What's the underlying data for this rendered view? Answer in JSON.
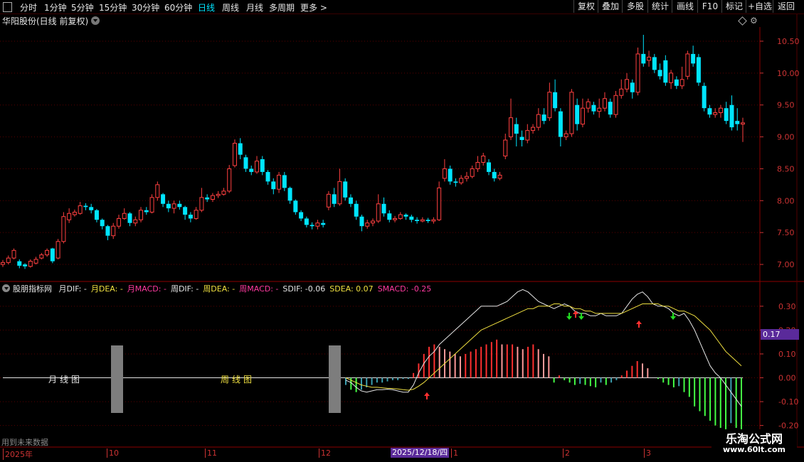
{
  "toolbar": {
    "periods": [
      "分时",
      "1分钟",
      "5分钟",
      "15分钟",
      "30分钟",
      "60分钟",
      "日线",
      "周线",
      "月线",
      "多周期",
      "更多"
    ],
    "active_period": "日线",
    "right_buttons": [
      "复权",
      "叠加",
      "多股",
      "统计",
      "画线",
      "F10",
      "标记",
      "+自选",
      "返回"
    ]
  },
  "chart_title": "华阳股份(日线 前复权)",
  "price_axis": [
    "10.50",
    "10.00",
    "9.50",
    "9.00",
    "8.50",
    "8.00",
    "7.50",
    "7.00"
  ],
  "indicator": {
    "name": "股朋指标网",
    "items": [
      {
        "text": "月DIF: -",
        "color": "#e6e6e6"
      },
      {
        "text": "月DEA: -",
        "color": "#f0e040"
      },
      {
        "text": "月MACD: -",
        "color": "#ff3aa0"
      },
      {
        "text": "周DIF: -",
        "color": "#e6e6e6"
      },
      {
        "text": "周DEA: -",
        "color": "#f0e040"
      },
      {
        "text": "周MACD: -",
        "color": "#ff3aa0"
      },
      {
        "text": "SDIF: -0.06",
        "color": "#e6e6e6"
      },
      {
        "text": "SDEA: 0.07",
        "color": "#f0e040"
      },
      {
        "text": "SMACD: -0.25",
        "color": "#ff3aa0"
      }
    ],
    "axis": [
      "0.30",
      "0.20",
      "0.10",
      "0.00",
      "-0.10",
      "-0.20"
    ],
    "current_value": "0.17",
    "month_label": "月线图",
    "week_label": "周线图"
  },
  "bottom_note": "用到未来数据",
  "date_axis": {
    "labels": [
      "2025年",
      "10",
      "11",
      "12",
      "1",
      "2",
      "3"
    ],
    "cursor_date": "2025/12/18/四"
  },
  "watermark": {
    "title": "乐淘公式网",
    "url": "www.60lt.com"
  },
  "colors": {
    "up": "#ff4040",
    "down": "#00e5ff",
    "grid": "#5a0000",
    "axis": "#cc3333"
  },
  "chart_data": {
    "type": "candlestick",
    "title": "华阳股份(日线 前复权)",
    "ylim": [
      6.8,
      10.7
    ],
    "candles": [
      [
        7.0,
        7.03,
        7.07,
        6.96
      ],
      [
        7.03,
        7.1,
        7.14,
        7.0
      ],
      [
        7.1,
        7.22,
        7.25,
        7.08
      ],
      [
        7.05,
        6.98,
        7.08,
        6.94
      ],
      [
        7.0,
        6.97,
        7.02,
        6.93
      ],
      [
        6.97,
        7.05,
        7.08,
        6.95
      ],
      [
        7.02,
        7.08,
        7.12,
        7.0
      ],
      [
        7.1,
        7.15,
        7.18,
        7.08
      ],
      [
        7.15,
        7.22,
        7.25,
        7.12
      ],
      [
        7.25,
        7.05,
        7.26,
        7.02
      ],
      [
        7.1,
        7.36,
        7.4,
        7.08
      ],
      [
        7.36,
        7.75,
        7.82,
        7.33
      ],
      [
        7.7,
        7.8,
        7.88,
        7.65
      ],
      [
        7.78,
        7.82,
        7.86,
        7.75
      ],
      [
        7.8,
        7.92,
        7.98,
        7.78
      ],
      [
        7.92,
        7.9,
        7.96,
        7.85
      ],
      [
        7.9,
        7.85,
        7.95,
        7.8
      ],
      [
        7.85,
        7.7,
        7.87,
        7.66
      ],
      [
        7.7,
        7.6,
        7.72,
        7.55
      ],
      [
        7.6,
        7.45,
        7.62,
        7.38
      ],
      [
        7.45,
        7.6,
        7.65,
        7.4
      ],
      [
        7.6,
        7.72,
        7.78,
        7.56
      ],
      [
        7.72,
        7.8,
        7.88,
        7.7
      ],
      [
        7.8,
        7.65,
        7.82,
        7.6
      ],
      [
        7.65,
        7.7,
        7.75,
        7.6
      ],
      [
        7.7,
        7.85,
        7.9,
        7.66
      ],
      [
        7.85,
        7.82,
        7.9,
        7.78
      ],
      [
        7.82,
        8.05,
        8.1,
        7.8
      ],
      [
        8.05,
        8.25,
        8.3,
        8.0
      ],
      [
        8.1,
        7.95,
        8.12,
        7.9
      ],
      [
        7.95,
        7.88,
        8.0,
        7.82
      ],
      [
        7.88,
        7.95,
        8.0,
        7.8
      ],
      [
        7.95,
        7.9,
        8.0,
        7.86
      ],
      [
        7.9,
        7.78,
        7.92,
        7.7
      ],
      [
        7.78,
        7.72,
        7.82,
        7.66
      ],
      [
        7.72,
        7.85,
        7.9,
        7.7
      ],
      [
        7.85,
        8.05,
        8.2,
        7.82
      ],
      [
        8.05,
        8.02,
        8.1,
        7.98
      ],
      [
        8.02,
        8.08,
        8.12,
        7.98
      ],
      [
        8.08,
        8.1,
        8.15,
        8.04
      ],
      [
        8.1,
        8.15,
        8.2,
        8.08
      ],
      [
        8.15,
        8.5,
        8.56,
        8.12
      ],
      [
        8.55,
        8.9,
        8.96,
        8.52
      ],
      [
        8.9,
        8.72,
        8.98,
        8.65
      ],
      [
        8.68,
        8.5,
        8.72,
        8.45
      ],
      [
        8.5,
        8.45,
        8.55,
        8.4
      ],
      [
        8.45,
        8.62,
        8.7,
        8.42
      ],
      [
        8.65,
        8.45,
        8.7,
        8.4
      ],
      [
        8.45,
        8.3,
        8.48,
        8.25
      ],
      [
        8.3,
        8.18,
        8.35,
        8.1
      ],
      [
        8.18,
        8.4,
        8.45,
        8.12
      ],
      [
        8.4,
        8.2,
        8.45,
        8.15
      ],
      [
        8.2,
        8.0,
        8.22,
        7.95
      ],
      [
        8.0,
        7.82,
        8.02,
        7.78
      ],
      [
        7.82,
        7.72,
        7.85,
        7.68
      ],
      [
        7.72,
        7.62,
        7.75,
        7.58
      ],
      [
        7.62,
        7.6,
        7.66,
        7.55
      ],
      [
        7.6,
        7.65,
        7.7,
        7.55
      ],
      [
        7.65,
        7.62,
        7.7,
        7.58
      ],
      [
        7.9,
        8.1,
        8.15,
        7.85
      ],
      [
        8.1,
        7.95,
        8.2,
        7.9
      ],
      [
        7.95,
        8.3,
        8.5,
        7.92
      ],
      [
        8.3,
        8.05,
        8.35,
        8.0
      ],
      [
        8.05,
        7.95,
        8.1,
        7.9
      ],
      [
        7.95,
        7.75,
        8.0,
        7.7
      ],
      [
        7.75,
        7.6,
        7.78,
        7.52
      ],
      [
        7.6,
        7.65,
        7.7,
        7.56
      ],
      [
        7.65,
        7.68,
        7.72,
        7.6
      ],
      [
        7.68,
        7.95,
        8.1,
        7.65
      ],
      [
        7.95,
        7.8,
        8.05,
        7.75
      ],
      [
        7.8,
        7.7,
        7.85,
        7.66
      ],
      [
        7.7,
        7.72,
        7.76,
        7.66
      ],
      [
        7.72,
        7.78,
        7.82,
        7.7
      ],
      [
        7.78,
        7.75,
        7.8,
        7.7
      ],
      [
        7.75,
        7.7,
        7.78,
        7.66
      ],
      [
        7.7,
        7.68,
        7.74,
        7.64
      ],
      [
        7.68,
        7.7,
        7.74,
        7.66
      ],
      [
        7.7,
        7.68,
        7.73,
        7.65
      ],
      [
        7.68,
        7.7,
        7.74,
        7.64
      ],
      [
        7.7,
        8.2,
        8.3,
        7.68
      ],
      [
        8.35,
        8.5,
        8.65,
        8.3
      ],
      [
        8.5,
        8.3,
        8.55,
        8.25
      ],
      [
        8.3,
        8.28,
        8.35,
        8.22
      ],
      [
        8.28,
        8.35,
        8.4,
        8.25
      ],
      [
        8.35,
        8.38,
        8.45,
        8.3
      ],
      [
        8.38,
        8.5,
        8.55,
        8.35
      ],
      [
        8.5,
        8.6,
        8.7,
        8.45
      ],
      [
        8.6,
        8.7,
        8.75,
        8.55
      ],
      [
        8.6,
        8.45,
        8.65,
        8.4
      ],
      [
        8.45,
        8.35,
        8.5,
        8.3
      ],
      [
        8.35,
        8.4,
        8.45,
        8.32
      ],
      [
        8.7,
        8.95,
        9.05,
        8.65
      ],
      [
        9.0,
        9.3,
        9.6,
        8.95
      ],
      [
        9.2,
        9.05,
        9.3,
        8.85
      ],
      [
        9.0,
        8.95,
        9.1,
        8.85
      ],
      [
        8.95,
        9.1,
        9.2,
        8.9
      ],
      [
        9.1,
        9.15,
        9.2,
        9.05
      ],
      [
        9.15,
        9.35,
        9.45,
        9.1
      ],
      [
        9.35,
        9.25,
        9.45,
        9.2
      ],
      [
        9.3,
        9.7,
        9.85,
        9.25
      ],
      [
        9.7,
        9.45,
        9.9,
        9.4
      ],
      [
        9.4,
        9.0,
        9.45,
        8.85
      ],
      [
        9.0,
        9.05,
        9.1,
        8.95
      ],
      [
        9.05,
        9.7,
        9.75,
        9.0
      ],
      [
        9.5,
        9.2,
        9.6,
        9.1
      ],
      [
        9.2,
        9.45,
        9.6,
        9.15
      ],
      [
        9.45,
        9.55,
        9.6,
        9.38
      ],
      [
        9.5,
        9.4,
        9.55,
        9.35
      ],
      [
        9.4,
        9.45,
        9.6,
        9.3
      ],
      [
        9.45,
        9.6,
        9.7,
        9.4
      ],
      [
        9.55,
        9.35,
        9.6,
        9.3
      ],
      [
        9.35,
        9.65,
        9.72,
        9.3
      ],
      [
        9.65,
        9.75,
        9.9,
        9.6
      ],
      [
        9.75,
        9.9,
        10.0,
        9.7
      ],
      [
        9.85,
        9.7,
        9.9,
        9.6
      ],
      [
        9.7,
        10.3,
        10.4,
        9.65
      ],
      [
        10.3,
        10.15,
        10.6,
        10.1
      ],
      [
        10.2,
        10.25,
        10.35,
        10.1
      ],
      [
        10.25,
        10.05,
        10.3,
        10.0
      ],
      [
        10.05,
        9.95,
        10.15,
        9.9
      ],
      [
        10.2,
        9.85,
        10.28,
        9.8
      ],
      [
        9.85,
        10.0,
        10.05,
        9.75
      ],
      [
        9.9,
        9.8,
        9.95,
        9.75
      ],
      [
        9.8,
        9.9,
        10.1,
        9.75
      ],
      [
        9.95,
        10.3,
        10.35,
        9.9
      ],
      [
        10.3,
        10.15,
        10.43,
        10.1
      ],
      [
        10.25,
        9.85,
        10.3,
        9.8
      ],
      [
        9.8,
        9.45,
        9.85,
        9.4
      ],
      [
        9.45,
        9.35,
        9.5,
        9.3
      ],
      [
        9.35,
        9.38,
        9.45,
        9.3
      ],
      [
        9.38,
        9.45,
        9.5,
        9.3
      ],
      [
        9.45,
        9.25,
        9.55,
        9.2
      ],
      [
        9.5,
        9.15,
        9.65,
        9.1
      ],
      [
        9.25,
        9.2,
        9.45,
        9.1
      ],
      [
        9.2,
        9.22,
        9.3,
        8.92
      ]
    ]
  }
}
